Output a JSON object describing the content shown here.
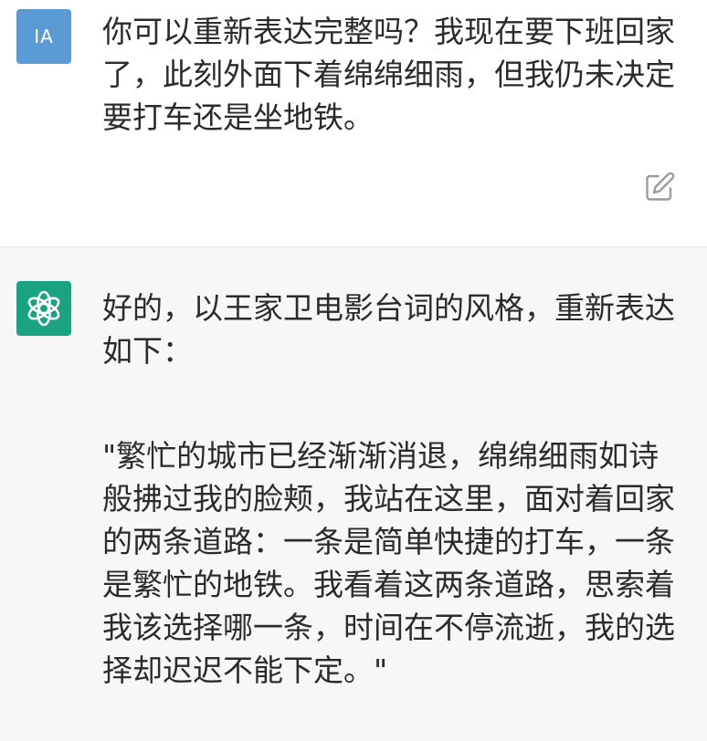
{
  "user": {
    "avatar_initials": "IA",
    "message": "你可以重新表达完整吗？我现在要下班回家了，此刻外面下着绵绵细雨，但我仍未决定要打车还是坐地铁。",
    "edit_icon": "edit-icon"
  },
  "assistant": {
    "avatar_icon": "openai-logo-icon",
    "intro": "好的，以王家卫电影台词的风格，重新表达如下：",
    "quote": "\"繁忙的城市已经渐渐消退，绵绵细雨如诗般拂过我的脸颊，我站在这里，面对着回家的两条道路：一条是简单快捷的打车，一条是繁忙的地铁。我看着这两条道路，思索着我该选择哪一条，时间在不停流逝，我的选择却迟迟不能下定。\""
  },
  "colors": {
    "user_avatar_bg": "#5b9bd5",
    "bot_avatar_bg": "#19a37f",
    "assistant_bg": "#f7f7f8"
  }
}
